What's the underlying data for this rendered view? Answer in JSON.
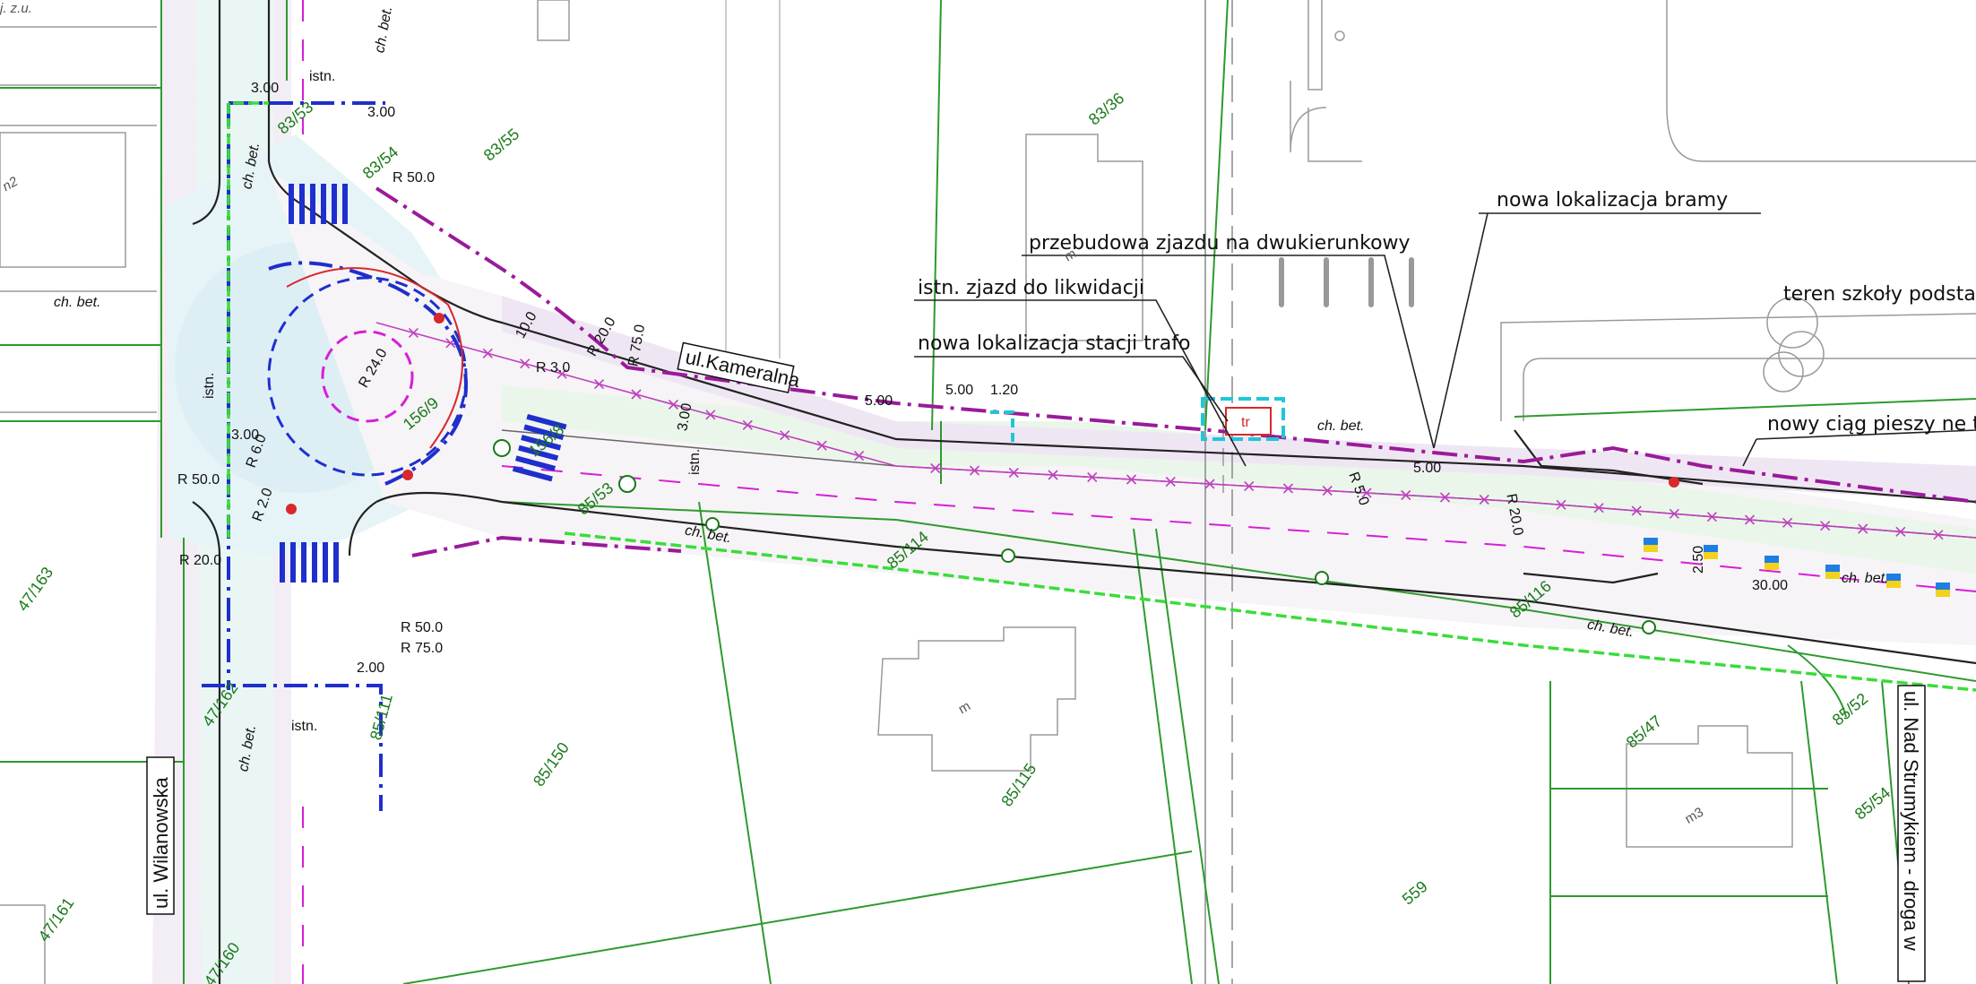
{
  "plan": {
    "streets": {
      "kameralna": "ul.Kameralna",
      "wilanowska": "ul. Wilanowska",
      "nad_strumykiem": "ul. Nad Strumykiem - droga w"
    },
    "callouts": {
      "gate": "nowa lokalizacja bramy",
      "driveway": "przebudowa zjazdu na dwukierunkowy",
      "old_driveway": "istn. zjazd do likwidacji",
      "transformer": "nowa lokalizacja stacji trafo",
      "school": "teren szkoły podstaw",
      "footpath": "nowy ciąg pieszy ne t"
    },
    "parcels": [
      "83/55",
      "83/36",
      "47/163",
      "85/150",
      "85/115",
      "85/114",
      "85/116",
      "85/47",
      "85/52",
      "85/54",
      "47/161",
      "47/160",
      "47/162",
      "559",
      "85/53",
      "83/54",
      "83/53",
      "85/111",
      "156/9",
      "156/8"
    ],
    "surface_labels": [
      "ch. bet.",
      "ch. bet.",
      "ch. bet.",
      "ch. bet.",
      "ch. bet.",
      "ch. bet.",
      "ch. bet.",
      "ch. bet."
    ],
    "existing_labels": [
      "istn.",
      "istn.",
      "istn.",
      "istn."
    ],
    "dimensions": [
      "3.00",
      "5.00",
      "5.00",
      "1.20",
      "3.00",
      "30.00",
      "2.50",
      "2.00",
      "3.00",
      "3.00",
      "5.00",
      "10.0"
    ],
    "radii": [
      "R 50.0",
      "R 20.0",
      "R 75.0",
      "R 3.0",
      "R 50.0",
      "R 20.0",
      "R 50.0",
      "R 75.0",
      "R 2.0",
      "R 6.0",
      "R 5.0",
      "R 20.0",
      "R 24.0"
    ],
    "building_labels": [
      "m",
      "m3",
      "m",
      "tr"
    ],
    "misc": [
      "j. z.u.",
      "n2"
    ],
    "colors": {
      "parcel_boundary": "#2e9a2e",
      "road_limit": "#9a1a9a",
      "project_limit": "#1f2fcc",
      "new_fence": "#3bdc3b",
      "cyan": "#1fc7d8",
      "red": "#d8282b"
    }
  }
}
